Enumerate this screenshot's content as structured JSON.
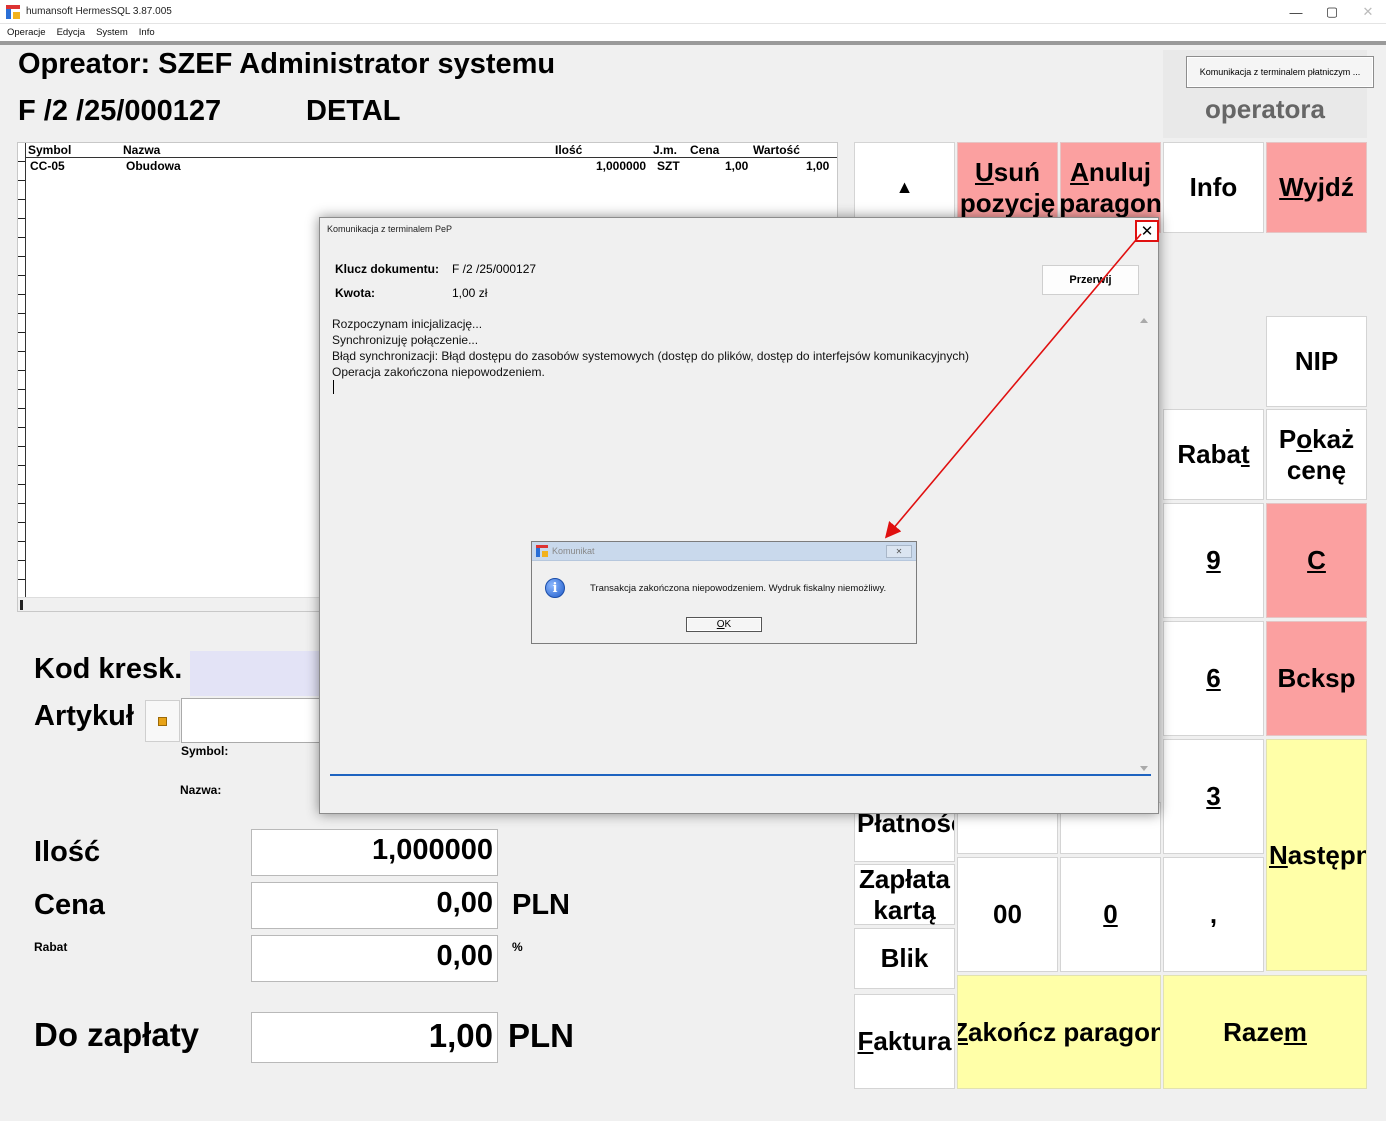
{
  "window": {
    "title": "humansoft HermesSQL 3.87.005",
    "minimize": "—",
    "maximize": "▢",
    "close": "✕"
  },
  "menu": [
    "Operacje",
    "Edycja",
    "System",
    "Info"
  ],
  "header": {
    "operator_label": "Opreator: SZEF Administrator systemu",
    "document_number": "F /2  /25/000127",
    "document_type": "DETAL"
  },
  "terminal": {
    "button_label": "Komunikacja z terminalem płatniczym ...",
    "operator_caption": "operatora"
  },
  "items_table": {
    "columns": [
      "Symbol",
      "Nazwa",
      "Ilość",
      "J.m.",
      "Cena",
      "Wartość"
    ],
    "rows": [
      {
        "symbol": "CC-05",
        "name": "Obudowa",
        "quantity": "1,000000",
        "unit": "SZT",
        "price": "1,00",
        "value": "1,00"
      }
    ]
  },
  "form": {
    "barcode_label": "Kod kresk.",
    "article_label": "Artykuł",
    "symbol_label": "Symbol:",
    "name_label": "Nazwa:",
    "quantity_label": "Ilość",
    "quantity_value": "1,000000",
    "price_label": "Cena",
    "price_value": "0,00",
    "price_unit": "PLN",
    "discount_label": "Rabat",
    "discount_value": "0,00",
    "discount_unit": "%",
    "to_pay_label": "Do zapłaty",
    "to_pay_value": "1,00",
    "to_pay_unit": "PLN"
  },
  "keypad": {
    "up": "▲",
    "delete_item_pre": "",
    "delete_item_underline": "U",
    "delete_item_rest": "suń pozycję",
    "cancel_receipt_underline": "A",
    "cancel_receipt_rest": "nuluj paragon",
    "info": "Info",
    "exit_underline": "W",
    "exit_rest": "yjdź",
    "nip": "NIP",
    "discount_pre": "Raba",
    "discount_underline": "t",
    "show_price_pre": "P",
    "show_price_underline": "o",
    "show_price_rest": "każ cenę",
    "nine": "9",
    "clear": "C",
    "six": "6",
    "backspace": "Bcksp",
    "three": "3",
    "next_underline": "N",
    "next_rest": "astępny",
    "payment_partial": "Płatność",
    "card_payment": "Zapłata kartą",
    "blik": "Blik",
    "double_zero": "00",
    "zero": "0",
    "comma": ",",
    "invoice_underline": "F",
    "invoice_rest": "aktura",
    "finish_receipt_underline": "Z",
    "finish_receipt_rest": "akończ paragon",
    "total_pre": "Raze",
    "total_underline": "m"
  },
  "pep_dialog": {
    "title": "Komunikacja z terminalem PeP",
    "close": "✕",
    "document_key_label": "Klucz dokumentu:",
    "document_key_value": "F /2  /25/000127",
    "amount_label": "Kwota:",
    "amount_value": "1,00 zł",
    "interrupt_button": "Przerwij",
    "log_lines": [
      "Rozpoczynam inicjalizację...",
      "Synchronizuję połączenie...",
      "Błąd synchronizacji: Błąd dostępu do zasobów systemowych (dostęp do plików, dostęp do interfejsów komunikacyjnych)",
      "Operacja zakończona niepowodzeniem."
    ]
  },
  "message_box": {
    "title": "Komunikat",
    "close": "✕",
    "icon": "i",
    "text": "Transakcja zakończona niepowodzeniem. Wydruk fiskalny niemożliwy.",
    "ok_underline": "O",
    "ok_rest": "K"
  },
  "colors": {
    "key_red": "#fba0a0",
    "key_yellow": "#ffffa8",
    "annotation_red": "#e01010",
    "barcode_input": "#e3e3f6"
  }
}
